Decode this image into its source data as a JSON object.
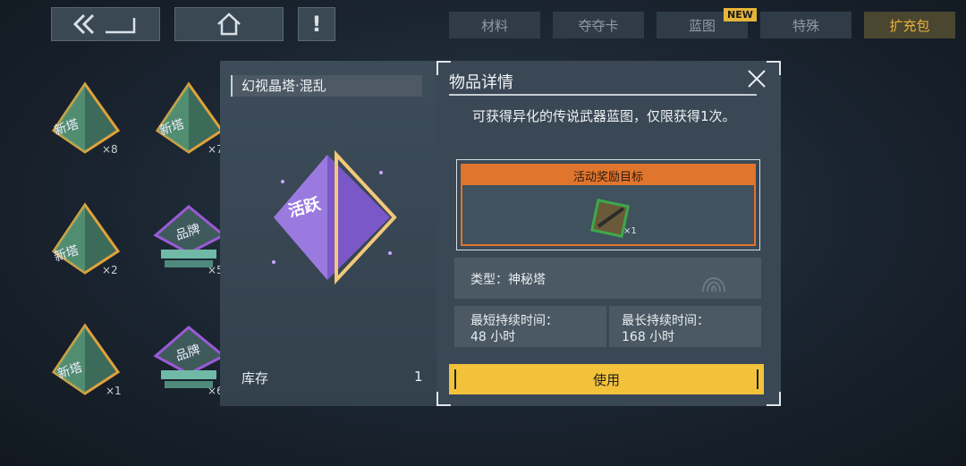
{
  "topbar": {
    "back_icon": "back-arrow-icon",
    "home_icon": "home-icon",
    "alert_label": "!"
  },
  "tabs": [
    {
      "label": "材料",
      "active": false
    },
    {
      "label": "夺夺卡",
      "active": false
    },
    {
      "label": "蓝图",
      "active": false,
      "badge": "NEW"
    },
    {
      "label": "特殊",
      "active": false
    },
    {
      "label": "扩充包",
      "active": true
    }
  ],
  "inventory": {
    "items": [
      {
        "label": "新塔",
        "count": "×8",
        "color": "#e0a23a"
      },
      {
        "label": "新塔",
        "count": "×7",
        "color": "#e0a23a"
      },
      {
        "label": "新塔",
        "count": "×2",
        "color": "#e0a23a"
      },
      {
        "label": "品牌",
        "count": "×5",
        "color": "#9a5ad8"
      },
      {
        "label": "新塔",
        "count": "×1",
        "color": "#e0a23a"
      },
      {
        "label": "品牌",
        "count": "×6",
        "color": "#9a5ad8"
      }
    ]
  },
  "item_panel": {
    "name": "幻视晶塔·混乱",
    "art_label": "活跃",
    "stock_label": "库存",
    "stock_value": "1"
  },
  "detail": {
    "title": "物品详情",
    "description": "可获得异化的传说武器蓝图，仅限获得1次。",
    "reward_header": "活动奖励目标",
    "reward_count": "×1",
    "type_text": "类型：神秘塔",
    "min_label": "最短持续时间：",
    "min_value": "48 小时",
    "max_label": "最长持续时间：",
    "max_value": "168 小时",
    "use_label": "使用",
    "colors": {
      "accent": "#f2c23a",
      "reward": "#e0752d"
    }
  }
}
